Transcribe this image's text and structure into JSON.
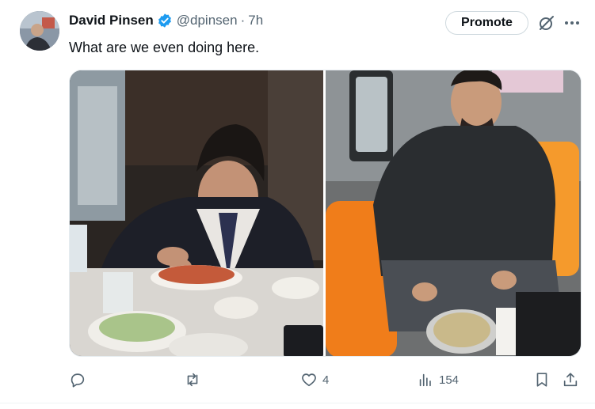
{
  "tweet": {
    "author_name": "David Pinsen",
    "handle": "@dpinsen",
    "separator": "·",
    "time": "7h",
    "text": "What are we even doing here.",
    "promote_label": "Promote"
  },
  "icons": {
    "verified": "verified-badge-icon",
    "grok": "grok-icon",
    "more": "more-icon",
    "reply": "reply-icon",
    "retweet": "retweet-icon",
    "like": "like-icon",
    "views": "views-icon",
    "bookmark": "bookmark-icon",
    "share": "share-icon"
  },
  "actions": {
    "reply_count": "",
    "retweet_count": "",
    "like_count": "4",
    "views_count": "154"
  },
  "colors": {
    "verified_blue": "#1d9bf0",
    "text_secondary": "#536471",
    "text_primary": "#0f1419",
    "seat_orange": "#f07d1a"
  }
}
